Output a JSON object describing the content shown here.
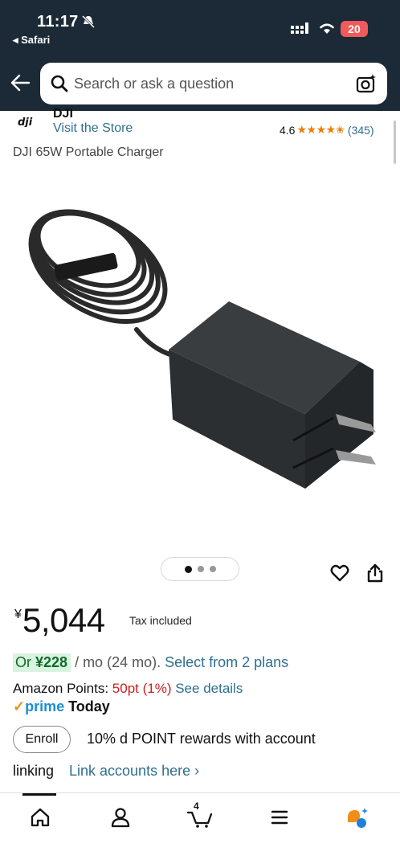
{
  "status_bar": {
    "time": "11:17",
    "back_app": "◂ Safari",
    "battery": "20"
  },
  "search": {
    "placeholder": "Search or ask a question"
  },
  "store": {
    "brand": "DJI",
    "visit_link": "Visit the Store",
    "rating_value": "4.6",
    "stars": "★★★★✬",
    "rating_count": "(345)"
  },
  "product": {
    "title": "DJI 65W Portable Charger",
    "image_pages": 3,
    "active_page": 1
  },
  "price": {
    "currency": "¥",
    "amount": "5,044",
    "tax_note": "Tax included"
  },
  "installment": {
    "or_label": "Or",
    "monthly_amount": "¥228",
    "term_text": " / mo (24 mo). ",
    "plans_link": "Select from 2 plans"
  },
  "points": {
    "label": "Amazon Points: ",
    "value": "50pt",
    "percent": " (1%) ",
    "details_link": "See details"
  },
  "prime": {
    "check": "✓",
    "word": "prime",
    "delivery": "Today"
  },
  "rewards": {
    "enroll_label": "Enroll",
    "text": "10% d POINT rewards with account",
    "text_cont": "linking",
    "link": "Link accounts here ›"
  },
  "bottom_nav": {
    "cart_count": "4"
  },
  "colors": {
    "header_bg": "#1b2a36",
    "link": "#2f6f8f",
    "star": "#e8800a",
    "prime_blue": "#1a8fd0",
    "points_red": "#cc1f1f",
    "installment_bg": "#d8f3de"
  }
}
